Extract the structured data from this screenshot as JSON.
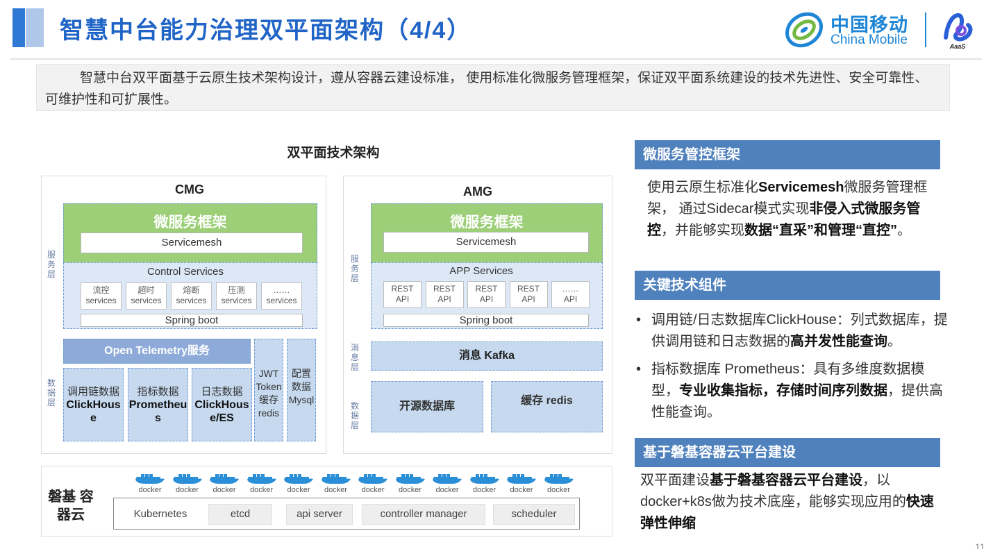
{
  "header": {
    "title": "智慧中台能力治理双平面架构（4/4）",
    "logo_cn": "中国移动",
    "logo_en": "China Mobile",
    "aaas_label": "AaaS"
  },
  "intro": "智慧中台双平面基于云原生技术架构设计，遵从容器云建设标准， 使用标准化微服务管理框架，保证双平面系统建设的技术先进性、安全可靠性、可维护性和可扩展性。",
  "diagram": {
    "title": "双平面技术架构",
    "cmg": {
      "label": "CMG",
      "microservice_title": "微服务框架",
      "servicemesh": "Servicemesh",
      "control_services": "Control Services",
      "services": [
        {
          "l1": "流控",
          "l2": "services"
        },
        {
          "l1": "超时",
          "l2": "services"
        },
        {
          "l1": "熔断",
          "l2": "services"
        },
        {
          "l1": "压测",
          "l2": "services"
        },
        {
          "l1": "……",
          "l2": "services"
        }
      ],
      "spring_boot": "Spring boot",
      "otel": "Open Telemetry服务",
      "jwt": "JWT Token 缓存 redis",
      "config": "配置 数据 Mysql",
      "data_boxes": [
        {
          "label": "调用链数据",
          "name": "ClickHouse"
        },
        {
          "label": "指标数据",
          "name": "Prometheus"
        },
        {
          "label": "日志数据",
          "name": "ClickHouse/ES"
        }
      ],
      "side_service": "服务层",
      "side_data": "数据层"
    },
    "amg": {
      "label": "AMG",
      "microservice_title": "微服务框架",
      "servicemesh": "Servicemesh",
      "app_services": "APP Services",
      "apis": [
        {
          "l1": "REST",
          "l2": "API"
        },
        {
          "l1": "REST",
          "l2": "API"
        },
        {
          "l1": "REST",
          "l2": "API"
        },
        {
          "l1": "REST",
          "l2": "API"
        },
        {
          "l1": "……",
          "l2": "API"
        }
      ],
      "spring_boot": "Spring boot",
      "kafka": "消息 Kafka",
      "open_db": "开源数据库",
      "cache": "缓存 redis",
      "side_service": "服务层",
      "side_msg": "消息层",
      "side_data": "数据层"
    },
    "base": {
      "label": "磐基 容器云",
      "docker_label": "docker",
      "docker_count": 12,
      "components": [
        "Kubernetes",
        "etcd",
        "api server",
        "controller manager",
        "scheduler"
      ]
    }
  },
  "right": {
    "s1": {
      "heading": "微服务管控框架",
      "p1": "使用云原生标准化",
      "p1b": "Servicemesh",
      "p2": "微服务管理框架， 通过Sidecar模式实现",
      "p2b": "非侵入式微服务管控",
      "p3": "，并能够实现",
      "p3b": "数据“直采”和管理“直控”",
      "p4": "。"
    },
    "s2": {
      "heading": "关键技术组件",
      "b1": "调用链/日志数据库ClickHouse：列式数据库，提供调用链和日志数据的",
      "b1b": "高并发性能查询",
      "b1c": "。",
      "b2": "指标数据库 Prometheus：具有多维度数据模型，",
      "b2b": "专业收集指标，存储时间序列数据",
      "b2c": "，提供高性能查询。"
    },
    "s3": {
      "heading": "基于磐基容器云平台建设",
      "p1": "双平面建设",
      "p1b": "基于磐基容器云平台建设",
      "p2": "，以docker+k8s做为技术底座，能够实现应用的",
      "p2b": "快速弹性伸缩"
    }
  },
  "page_number": "11",
  "colors": {
    "title_blue": "#1f64c6",
    "heading_blue": "#4f81bd",
    "green": "#9ccf78",
    "light_blue": "#c6d9ef"
  }
}
